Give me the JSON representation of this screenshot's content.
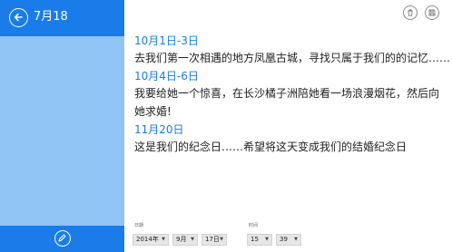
{
  "sidebar": {
    "title": "7月18"
  },
  "entries": [
    {
      "date": "10月1日-3日",
      "text": "去我们第一次相遇的地方凤凰古城，寻找只属于我们的的记忆……"
    },
    {
      "date": "10月4日-6日",
      "text": "我要给她一个惊喜，在长沙橘子洲陪她看一场浪漫烟花，然后向她求婚!"
    },
    {
      "date": "11月20日",
      "text": "这是我们的纪念日……希望将这天变成我们的结婚纪念日"
    }
  ],
  "date_picker": {
    "label": "日期",
    "year": "2014年",
    "month": "9月",
    "day": "17日"
  },
  "time_picker": {
    "label": "时间",
    "hour": "15",
    "minute": "39"
  },
  "icons": {
    "back": "back-arrow-icon",
    "edit": "pencil-icon",
    "delete": "trash-icon",
    "save": "save-icon"
  },
  "colors": {
    "accent": "#1a7ce8",
    "sidebar": "#8fc4f4",
    "date_text": "#1a7ce8",
    "body_text": "#222222"
  }
}
